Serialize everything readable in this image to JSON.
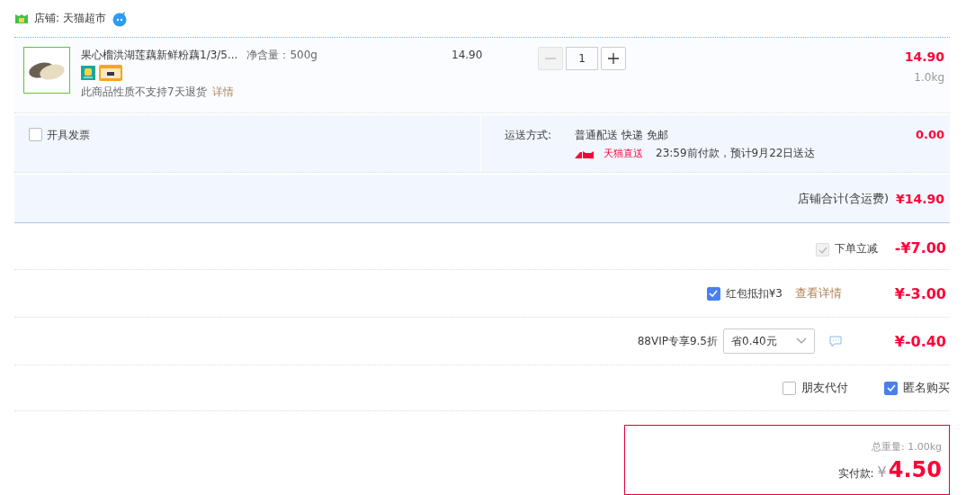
{
  "shop": {
    "label": "店铺: 天猫超市"
  },
  "item": {
    "title": "果心榴洪湖莲藕新鲜粉藕1/3/5...",
    "spec": "净含量：500g",
    "unit_price": "14.90",
    "quantity": "1",
    "minus_disabled": true,
    "total": "14.90",
    "weight": "1.0kg",
    "note": "此商品性质不支持7天退货",
    "note_link": "详情"
  },
  "invoice": {
    "label": "开具发票",
    "checked": false
  },
  "shipping": {
    "label": "运送方式:",
    "method": "普通配送 快递 免邮",
    "badge": "天猫直送",
    "eta": "23:59前付款，预计9月22日送达",
    "fee": "0.00"
  },
  "store_total": {
    "label": "店铺合计(含运费)",
    "amount": "¥14.90"
  },
  "discounts": [
    {
      "kind": "instant",
      "label": "下单立减",
      "checked": true,
      "disabled": true,
      "amount": "-¥7.00"
    },
    {
      "kind": "redpacket",
      "label": "红包抵扣¥3",
      "checked": true,
      "disabled": false,
      "link": "查看详情",
      "amount": "¥-3.00"
    },
    {
      "kind": "vip",
      "label": "88VIP专享9.5折",
      "select": "省0.40元",
      "amount": "¥-0.40"
    }
  ],
  "options": [
    {
      "label": "朋友代付",
      "checked": false
    },
    {
      "label": "匿名购买",
      "checked": true
    }
  ],
  "payment": {
    "weight": "总重量: 1.00kg",
    "label": "实付款:",
    "currency": "¥",
    "amount": "4.50"
  }
}
